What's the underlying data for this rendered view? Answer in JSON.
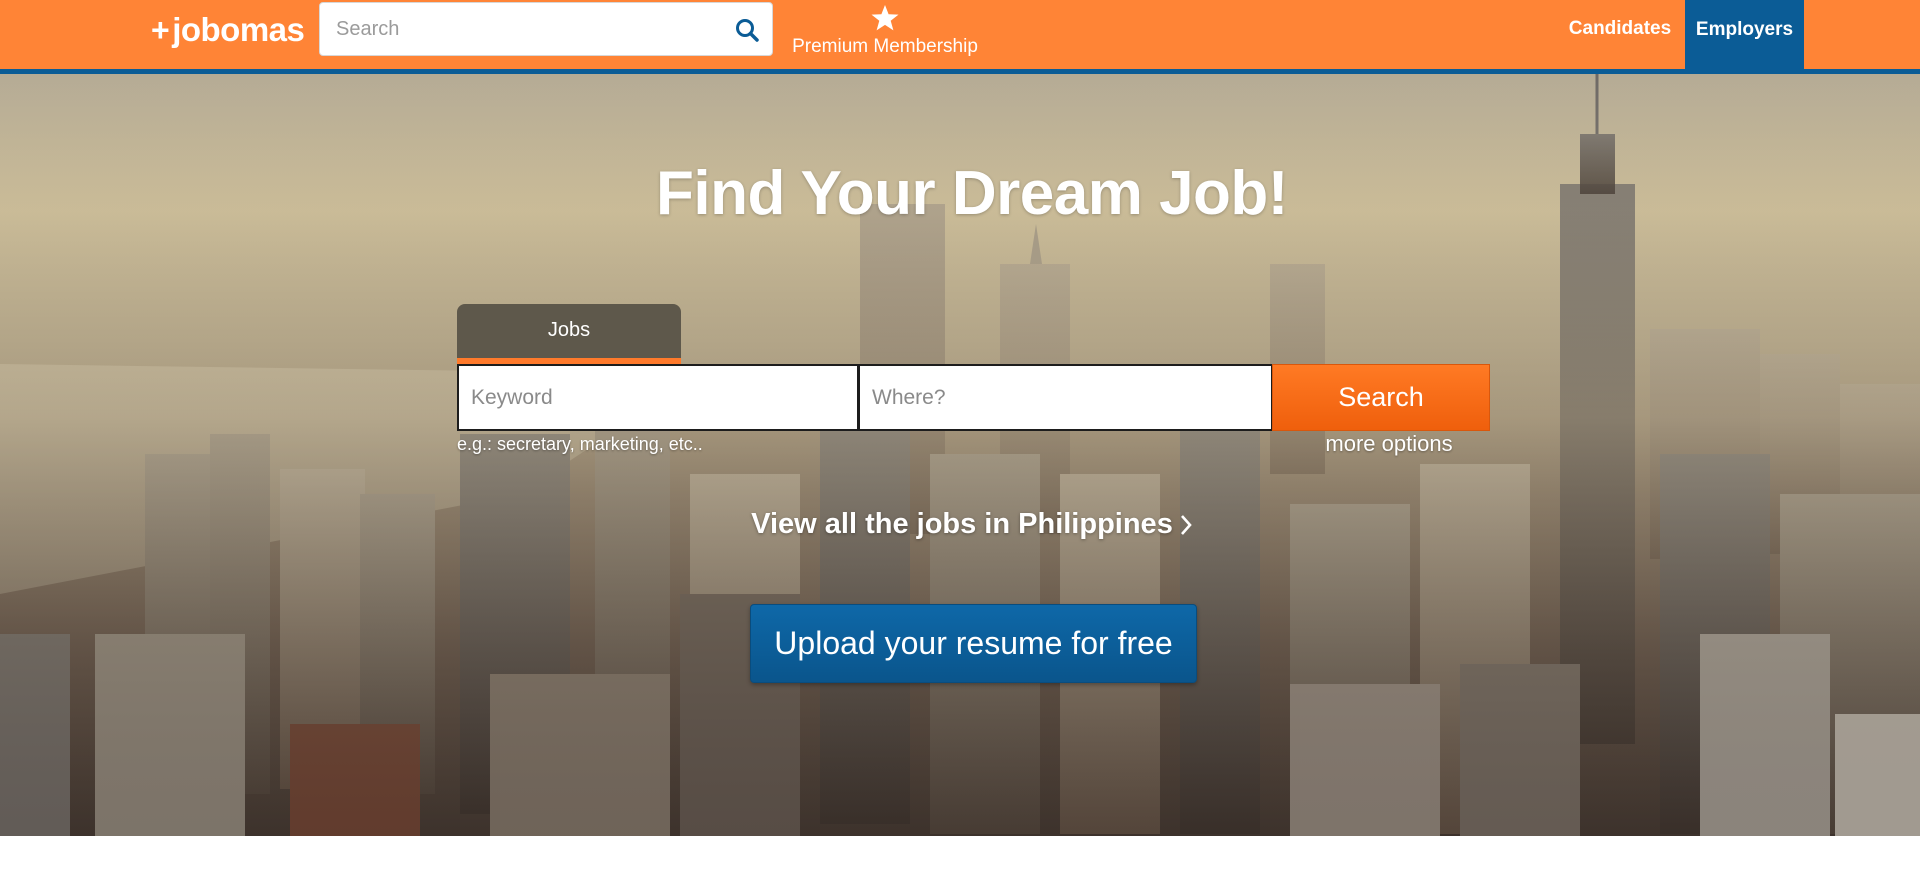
{
  "header": {
    "logo_plus": "+",
    "logo_text": "jobomas",
    "search": {
      "placeholder": "Search"
    },
    "premium": {
      "label": "Premium Membership",
      "icon": "star-icon"
    },
    "nav": {
      "candidates": "Candidates",
      "employers": "Employers"
    }
  },
  "hero": {
    "title": "Find Your Dream Job!",
    "tabs": [
      {
        "label": "Jobs",
        "active": true
      }
    ],
    "keyword": {
      "placeholder": "Keyword"
    },
    "where": {
      "placeholder": "Where?"
    },
    "search_button": "Search",
    "hint": "e.g.: secretary, marketing, etc..",
    "more_options": "more options",
    "view_all": "View all the jobs in Philippines",
    "upload_button": "Upload your resume for free"
  },
  "colors": {
    "brand_orange": "#ff8436",
    "brand_blue": "#0b5c96",
    "search_orange": "#f06a14",
    "tab_dark": "#5e584b"
  }
}
